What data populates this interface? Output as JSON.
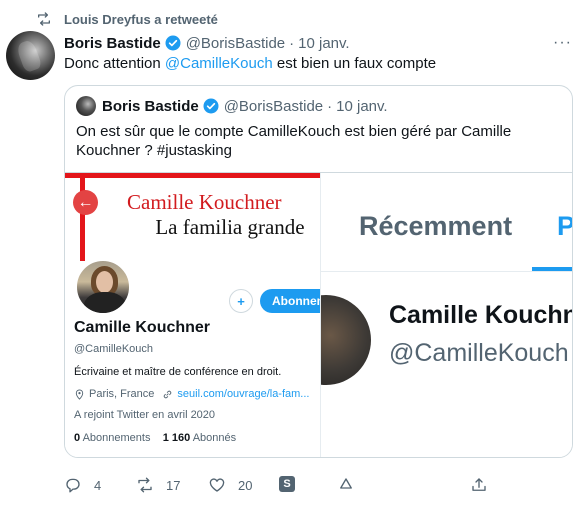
{
  "retweet": {
    "label": "Louis Dreyfus a retweeté"
  },
  "tweet": {
    "author_name": "Boris Bastide",
    "author_handle": "@BorisBastide",
    "separator": "·",
    "date": "10 janv.",
    "more": "···",
    "text_before": "Donc attention ",
    "mention": "@CamilleKouch",
    "text_after": " est bien un faux compte"
  },
  "quoted": {
    "author_name": "Boris Bastide",
    "author_handle": "@BorisBastide",
    "separator": "·",
    "date": "10 janv.",
    "text": "On est sûr que le compte CamilleKouch est bien géré par Camille Kouchner ? #justasking"
  },
  "media_left": {
    "book_author": "Camille Kouchner",
    "book_title": "La familia grande",
    "follow_label": "Abonnement",
    "profile_name": "Camille Kouchner",
    "profile_handle": "@CamilleKouch",
    "bio": "Écrivaine et maître de conférence en droit.",
    "location": "Paris, France",
    "link": "seuil.com/ouvrage/la-fam...",
    "joined": "A rejoint Twitter en avril 2020",
    "following_count": "0",
    "following_label": "Abonnements",
    "followers_count": "1 160",
    "followers_label": "Abonnés"
  },
  "media_right": {
    "tab_label": "Récemment",
    "tab_label_cut": "P",
    "profile_name": "Camille Kouchn",
    "profile_handle": "@CamilleKouch"
  },
  "actions": {
    "replies": "4",
    "retweets": "17",
    "likes": "20",
    "s_badge": "S"
  }
}
